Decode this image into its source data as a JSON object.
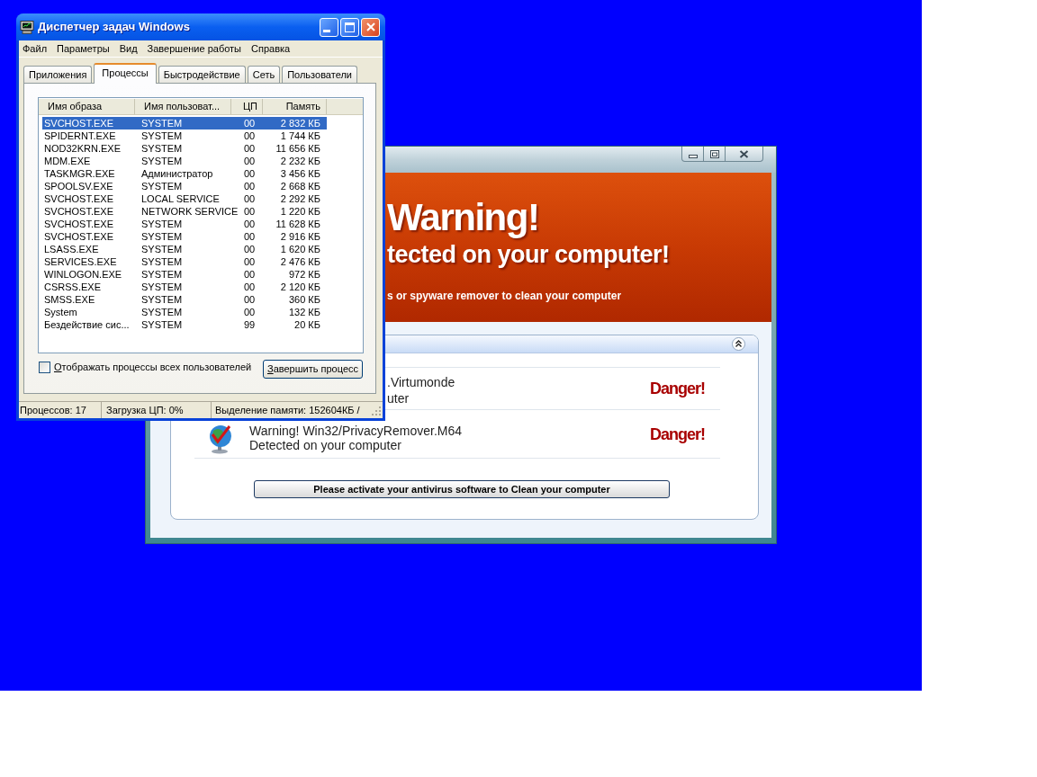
{
  "warning_window": {
    "banner": {
      "title": "Warning!",
      "subtitle": "tected on your computer!",
      "hint": "s or spyware remover to clean your computer"
    },
    "threats": [
      {
        "kind": "text",
        "name": ".Virtumonde",
        "detail": "uter",
        "status": "Danger!"
      },
      {
        "kind": "icon",
        "name": "Warning! Win32/PrivacyRemover.M64",
        "detail": "Detected on your computer",
        "status": "Danger!"
      }
    ],
    "button": "Please activate your antivirus software to Clean your computer"
  },
  "task_manager": {
    "title": "Диспетчер задач Windows",
    "menu": [
      "Файл",
      "Параметры",
      "Вид",
      "Завершение работы",
      "Справка"
    ],
    "tabs": [
      {
        "label": "Приложения",
        "selected": false
      },
      {
        "label": "Процессы",
        "selected": true
      },
      {
        "label": "Быстродействие",
        "selected": false
      },
      {
        "label": "Сеть",
        "selected": false
      },
      {
        "label": "Пользователи",
        "selected": false
      }
    ],
    "table": {
      "columns": [
        "Имя образа",
        "Имя пользоват...",
        "ЦП",
        "Память"
      ],
      "rows": [
        {
          "cells": [
            "SVCHOST.EXE",
            "SYSTEM",
            "00",
            "2 832 КБ"
          ],
          "selected": true
        },
        {
          "cells": [
            "SPIDERNT.EXE",
            "SYSTEM",
            "00",
            "1 744 КБ"
          ],
          "selected": false
        },
        {
          "cells": [
            "NOD32KRN.EXE",
            "SYSTEM",
            "00",
            "11 656 КБ"
          ],
          "selected": false
        },
        {
          "cells": [
            "MDM.EXE",
            "SYSTEM",
            "00",
            "2 232 КБ"
          ],
          "selected": false
        },
        {
          "cells": [
            "TASKMGR.EXE",
            "Администратор",
            "00",
            "3 456 КБ"
          ],
          "selected": false
        },
        {
          "cells": [
            "SPOOLSV.EXE",
            "SYSTEM",
            "00",
            "2 668 КБ"
          ],
          "selected": false
        },
        {
          "cells": [
            "SVCHOST.EXE",
            "LOCAL SERVICE",
            "00",
            "2 292 КБ"
          ],
          "selected": false
        },
        {
          "cells": [
            "SVCHOST.EXE",
            "NETWORK SERVICE",
            "00",
            "1 220 КБ"
          ],
          "selected": false
        },
        {
          "cells": [
            "SVCHOST.EXE",
            "SYSTEM",
            "00",
            "11 628 КБ"
          ],
          "selected": false
        },
        {
          "cells": [
            "SVCHOST.EXE",
            "SYSTEM",
            "00",
            "2 916 КБ"
          ],
          "selected": false
        },
        {
          "cells": [
            "LSASS.EXE",
            "SYSTEM",
            "00",
            "1 620 КБ"
          ],
          "selected": false
        },
        {
          "cells": [
            "SERVICES.EXE",
            "SYSTEM",
            "00",
            "2 476 КБ"
          ],
          "selected": false
        },
        {
          "cells": [
            "WINLOGON.EXE",
            "SYSTEM",
            "00",
            "972 КБ"
          ],
          "selected": false
        },
        {
          "cells": [
            "CSRSS.EXE",
            "SYSTEM",
            "00",
            "2 120 КБ"
          ],
          "selected": false
        },
        {
          "cells": [
            "SMSS.EXE",
            "SYSTEM",
            "00",
            "360 КБ"
          ],
          "selected": false
        },
        {
          "cells": [
            "System",
            "SYSTEM",
            "00",
            "132 КБ"
          ],
          "selected": false
        },
        {
          "cells": [
            "Бездействие сис...",
            "SYSTEM",
            "99",
            "20 КБ"
          ],
          "selected": false
        }
      ]
    },
    "show_all": {
      "label": "Отображать процессы всех пользователей",
      "checked": false
    },
    "end_process_button": "Завершить процесс",
    "status_bar": [
      "Процессов: 17",
      "Загрузка ЦП: 0%",
      "Выделение памяти: 152604КБ /"
    ]
  }
}
